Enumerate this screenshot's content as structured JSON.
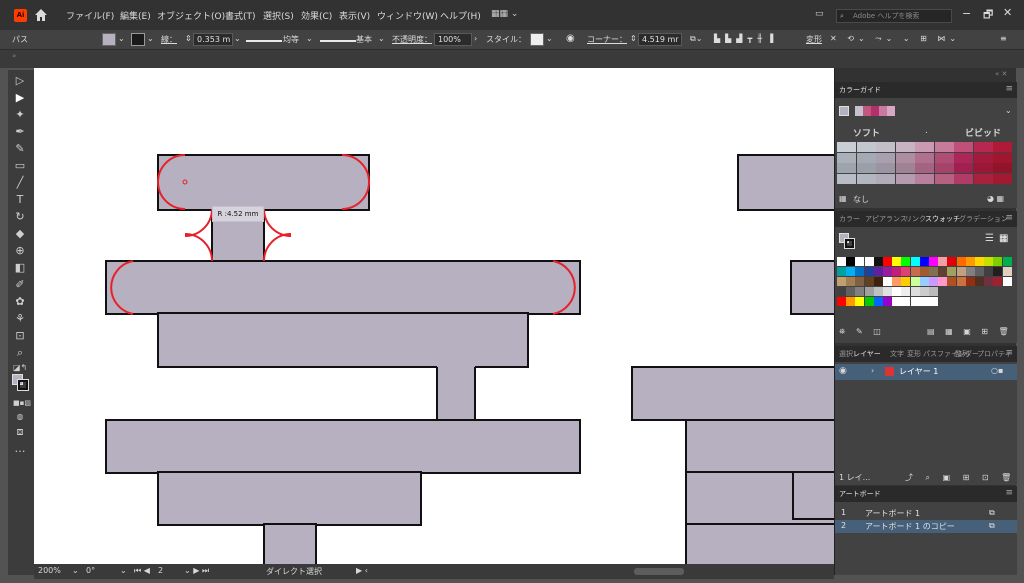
{
  "menubar": {
    "app_logo": "Ai",
    "items": [
      "ファイル(F)",
      "編集(E)",
      "オブジェクト(O)",
      "書式(T)",
      "選択(S)",
      "効果(C)",
      "表示(V)",
      "ウィンドウ(W)",
      "ヘルプ(H)"
    ],
    "search_placeholder": "Adobe ヘルプを検索",
    "window_controls": [
      "−",
      "🗗",
      "✕"
    ]
  },
  "controlbar": {
    "selection_label": "パス",
    "stroke_label": "線：",
    "stroke_value": "0.353 m",
    "uniform_label": "均等",
    "basic_label": "基本",
    "opacity_label": "不透明度：",
    "opacity_value": "100%",
    "style_label": "スタイル：",
    "corner_label": "コーナー：",
    "corner_value": "4.519 mr",
    "transform_label": "変形"
  },
  "canvas": {
    "tooltip_radius": "R :4.52 mm",
    "shape_fill": "#b6b0c0",
    "corner_highlight": "#e8202a"
  },
  "statusbar": {
    "zoom": "200%",
    "rotation": "0°",
    "artboard_number": "2",
    "tool_name": "ダイレクト選択"
  },
  "colorguide": {
    "title": "カラーガイド",
    "soft_label": "ソフト",
    "vivid_label": "ビビッド",
    "none_label": "なし",
    "grid_colors": [
      [
        "#c9ced6",
        "#c2c6ce",
        "#c3bfc9",
        "#c7b3c2",
        "#c99ab2",
        "#c67b9a",
        "#c05079",
        "#b82750",
        "#b01a37"
      ],
      [
        "#aab0ba",
        "#a5a9b4",
        "#a99fae",
        "#ad8da1",
        "#b07190",
        "#b04d74",
        "#ac2658",
        "#a41a3c",
        "#a0162e"
      ],
      [
        "#9da4ae",
        "#9aa0aa",
        "#9c94a2",
        "#9f8296",
        "#a56384",
        "#a5446b",
        "#a22050",
        "#9c1737",
        "#93142a"
      ],
      [
        "#b7bcc6",
        "#b1b6c0",
        "#b2abb9",
        "#b49cae",
        "#b6809e",
        "#b5617f",
        "#b03c65",
        "#a8223d",
        "#a21932"
      ]
    ]
  },
  "swatches_tabs": [
    "カラー",
    "アピアランス",
    "リンク",
    "スウォッチ",
    "グラデーション"
  ],
  "layers": {
    "tabs": [
      "選択",
      "レイヤー",
      "文字",
      "変形",
      "パスファインダー",
      "整列",
      "プロパティ"
    ],
    "layer_name": "レイヤー 1",
    "footer_count": "1 レイ..."
  },
  "artboards": {
    "title": "アートボード",
    "rows": [
      {
        "num": "1",
        "name": "アートボード 1"
      },
      {
        "num": "2",
        "name": "アートボード 1 のコピー"
      }
    ]
  }
}
